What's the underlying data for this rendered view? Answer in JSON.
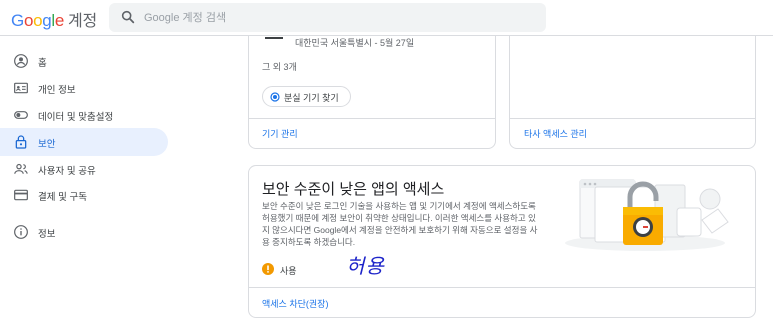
{
  "header": {
    "logo_text": "Google",
    "product": "계정",
    "search_placeholder": "Google 계정 검색"
  },
  "sidebar": {
    "items": [
      {
        "label": "홈",
        "icon": "home-icon"
      },
      {
        "label": "개인 정보",
        "icon": "id-card-icon"
      },
      {
        "label": "데이터 및 맞춤설정",
        "icon": "toggle-icon"
      },
      {
        "label": "보안",
        "icon": "lock-icon",
        "active": true
      },
      {
        "label": "사용자 및 공유",
        "icon": "people-icon"
      },
      {
        "label": "결제 및 구독",
        "icon": "credit-card-icon"
      },
      {
        "label": "정보",
        "icon": "info-icon"
      }
    ]
  },
  "devices_card": {
    "location": "대한민국 서울특별시 - 5월 27일",
    "others": "그 외 3개",
    "find_button": "분실 기기 찾기",
    "manage_link": "기기 관리"
  },
  "third_party_card": {
    "manage_link": "타사 액세스 관리"
  },
  "less_secure_card": {
    "title": "보안 수준이 낮은 앱의 액세스",
    "description": "보안 수준이 낮은 로그인 기술을 사용하는 앱 및 기기에서 계정에 액세스하도록 허용했기 때문에 계정 보안이 취약한 상태입니다. 이러한 액세스를 사용하고 있지 않으시다면 Google에서 계정을 안전하게 보호하기 위해 자동으로 설정을 사용 중지하도록 하겠습니다.",
    "status": "사용",
    "handwritten_note": "허용",
    "block_link": "액세스 차단(권장)"
  },
  "colors": {
    "accent": "#1a73e8",
    "active_bg": "#e8f0fe",
    "warning": "#f29900",
    "handwriting": "#1d24c9"
  }
}
